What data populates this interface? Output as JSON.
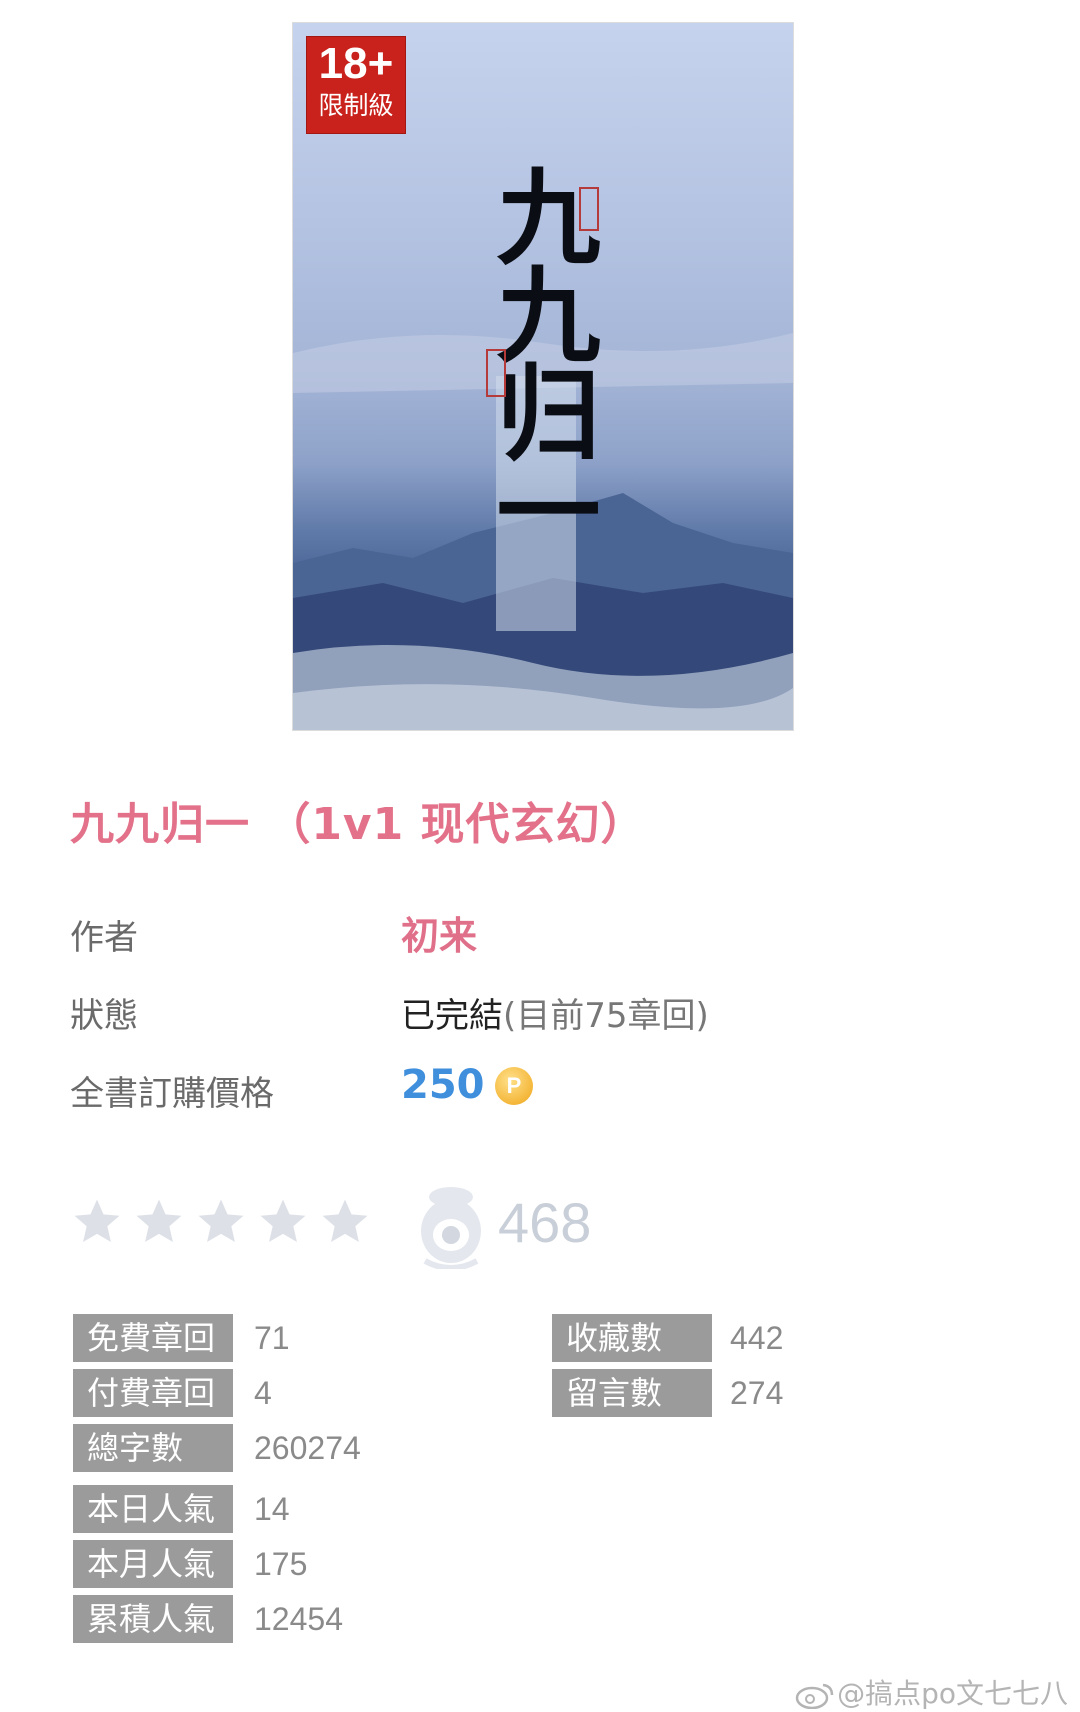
{
  "cover": {
    "badge_number": "18+",
    "badge_text": "限制級",
    "calligraphy": "九九归一"
  },
  "book": {
    "title": "九九归一 （1v1 现代玄幻）"
  },
  "info": {
    "author_label": "作者",
    "author_value": "初来",
    "status_label": "狀態",
    "status_value": "已完結",
    "status_detail": "(目前75章回)",
    "price_label": "全書訂購價格",
    "price_value": "250",
    "coin_symbol": "P"
  },
  "rating": {
    "stars_filled": 0,
    "stars_total": 5,
    "fans_count": "468"
  },
  "stats_left": [
    {
      "label": "免費章回",
      "value": "71"
    },
    {
      "label": "付費章回",
      "value": "4"
    },
    {
      "label": "總字數",
      "value": "260274"
    },
    {
      "label": "本日人氣",
      "value": "14"
    },
    {
      "label": "本月人氣",
      "value": "175"
    },
    {
      "label": "累積人氣",
      "value": "12454"
    }
  ],
  "stats_right": [
    {
      "label": "收藏數",
      "value": "442"
    },
    {
      "label": "留言數",
      "value": "274"
    }
  ],
  "watermark": "@搞点po文七七八",
  "colors": {
    "title_pink": "#e27189",
    "price_blue": "#3f8fdc",
    "label_gray": "#9b9b9b",
    "badge_red": "#c9211c"
  }
}
